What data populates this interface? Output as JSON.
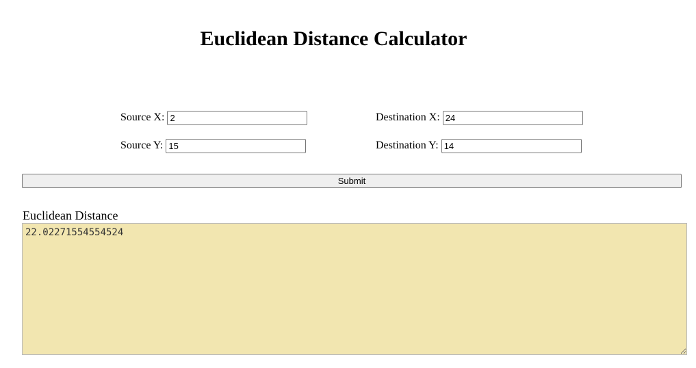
{
  "page": {
    "title": "Euclidean Distance Calculator"
  },
  "form": {
    "source_x": {
      "label": "Source X:",
      "value": "2"
    },
    "source_y": {
      "label": "Source Y:",
      "value": "15"
    },
    "destination_x": {
      "label": "Destination X:",
      "value": "24"
    },
    "destination_y": {
      "label": "Destination Y:",
      "value": "14"
    },
    "submit_label": "Submit"
  },
  "result": {
    "label": "Euclidean Distance",
    "value": "22.02271554554524"
  },
  "colors": {
    "result_background": "#f2e6b0",
    "button_background": "#efefef"
  }
}
